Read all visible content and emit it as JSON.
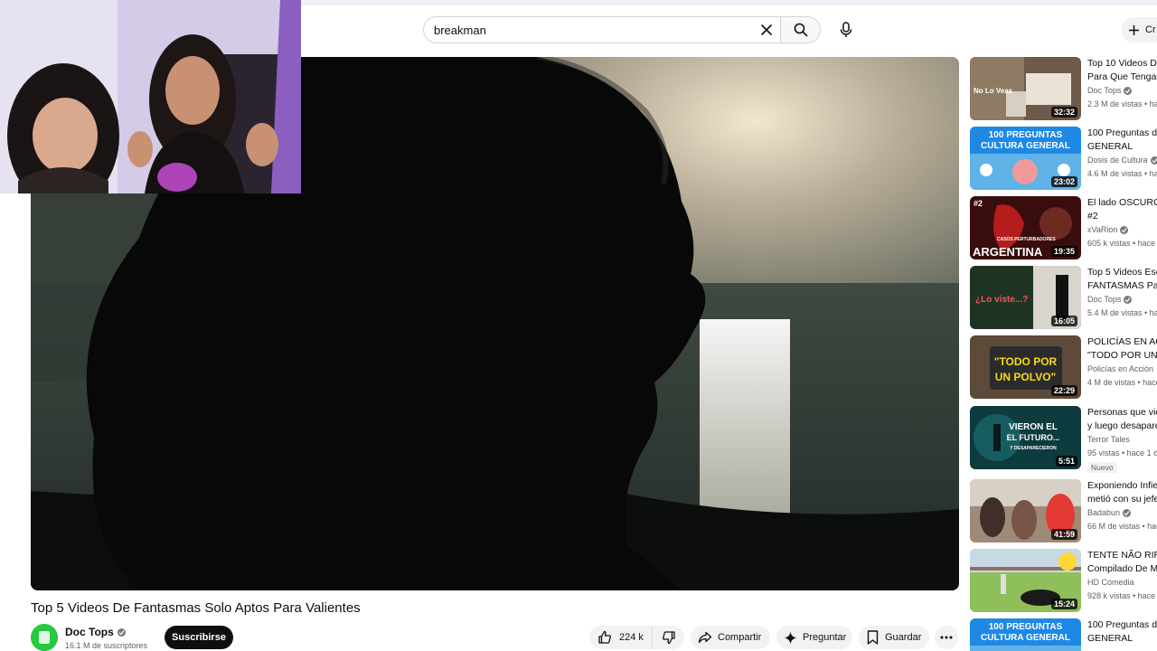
{
  "search": {
    "value": "breakman"
  },
  "header": {
    "create_label": "Cr"
  },
  "video": {
    "title": "Top 5 Videos De Fantasmas Solo Aptos Para Valientes",
    "channel": "Doc Tops",
    "subscribers": "16.1 M de suscriptores",
    "subscribe_label": "Suscribirse",
    "likes": "224 k",
    "share_label": "Compartir",
    "ask_label": "Preguntar",
    "save_label": "Guardar"
  },
  "recommendations": [
    {
      "title_lines": [
        "Top 10 Videos De",
        "Para Que Tengas"
      ],
      "channel": "Doc Tops",
      "verified": true,
      "meta": "2.3 M de vistas • hace",
      "duration": "32:32",
      "thumb_text": "No Lo Veas",
      "thumb_accent": "#c0392b"
    },
    {
      "title_lines": [
        "100 Preguntas de",
        "GENERAL"
      ],
      "channel": "Dosis de Cultura",
      "verified": true,
      "meta": "4.6 M de vistas • hace",
      "duration": "23:02",
      "thumb_text": "100 PREGUNTAS",
      "thumb_text2": "CULTURA GENERAL",
      "thumb_accent": "#1e88e5"
    },
    {
      "title_lines": [
        "El lado OSCURO d",
        "#2"
      ],
      "channel": "xVaRion",
      "verified": true,
      "meta": "605 k vistas • hace",
      "duration": "19:35",
      "thumb_text": "#2",
      "thumb_text2": "CASOS PERTURBADORES",
      "thumb_text3": "ARGENTINA",
      "thumb_accent": "#b71c1c"
    },
    {
      "title_lines": [
        "Top 5 Videos Esc",
        "FANTASMAS Par"
      ],
      "channel": "Doc Tops",
      "verified": true,
      "meta": "5.4 M de vistas • hace",
      "duration": "16:05",
      "thumb_text": "¿Lo viste...?",
      "thumb_accent": "#2e7d32"
    },
    {
      "title_lines": [
        "POLICÍAS EN AC",
        "\"TODO POR UN P"
      ],
      "channel": "Policías en Acción",
      "verified": false,
      "meta": "4 M de vistas • hace",
      "duration": "22:29",
      "thumb_text": "\"TODO POR",
      "thumb_text2": "UN POLVO\"",
      "thumb_accent": "#f9d71c"
    },
    {
      "title_lines": [
        "Personas que vie",
        "y luego desapare"
      ],
      "channel": "Terror Tales",
      "verified": false,
      "meta": "95 vistas • hace 1 d",
      "duration": "5:51",
      "badge": "Nuevo",
      "thumb_text": "VIERON EL",
      "thumb_text2": "EL FUTURO...",
      "thumb_text3": "Y DESAPARECIERON",
      "thumb_accent": "#0d3b3e"
    },
    {
      "title_lines": [
        "Exponiendo Infie",
        "metió con su jefe"
      ],
      "channel": "Badabun",
      "verified": true,
      "meta": "66 M de vistas • hace",
      "duration": "41:59",
      "thumb_accent": "#8d6e63"
    },
    {
      "title_lines": [
        "TENTE NÃO RIR",
        "Compilado De M"
      ],
      "channel": "HD Comedia",
      "verified": false,
      "meta": "928 k vistas • hace",
      "duration": "15:24",
      "thumb_accent": "#7cb342"
    },
    {
      "title_lines": [
        "100 Preguntas de",
        "GENERAL"
      ],
      "channel": "",
      "verified": false,
      "meta": "",
      "duration": "",
      "thumb_text": "100 PREGUNTAS",
      "thumb_text2": "CULTURA GENERAL",
      "thumb_accent": "#1e88e5"
    }
  ],
  "colors": {
    "accent": "#0f0f0f",
    "subscribe_bg": "#0f0f0f",
    "pill_bg": "#f2f2f2",
    "muted_text": "#606060"
  },
  "icons": {
    "clear": "close-icon",
    "search": "search-icon",
    "mic": "mic-icon",
    "create": "plus-icon",
    "like": "thumbs-up-icon",
    "dislike": "thumbs-down-icon",
    "share": "share-icon",
    "ask": "sparkle-icon",
    "save": "bookmark-icon",
    "more": "more-horizontal-icon"
  }
}
